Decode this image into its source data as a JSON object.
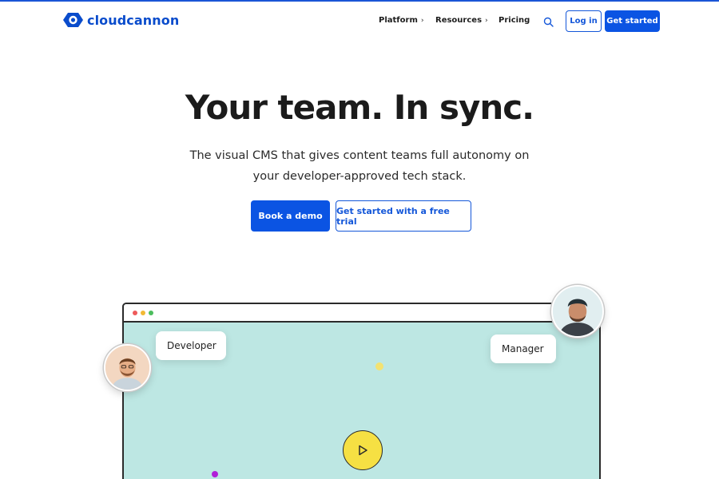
{
  "brand": {
    "name": "cloudcannon",
    "accent": "#0b54e3"
  },
  "nav": {
    "items": [
      {
        "label": "Platform",
        "has_submenu": true
      },
      {
        "label": "Resources",
        "has_submenu": true
      },
      {
        "label": "Pricing",
        "has_submenu": false
      }
    ],
    "chevron": "›",
    "search_icon": "search-icon",
    "login_label": "Log in",
    "get_started_label": "Get started"
  },
  "hero": {
    "title": "Your team. In sync.",
    "subtitle": "The visual CMS that gives content teams full autonomy on your developer-approved tech stack.",
    "primary_cta": "Book a demo",
    "secondary_cta": "Get started with a free trial"
  },
  "illustration": {
    "developer_label": "Developer",
    "manager_label": "Manager",
    "play_icon": "play-icon",
    "colors": {
      "panel": "#bde7e3",
      "play_button": "#f6e043",
      "purple_dot": "#b020d8"
    }
  }
}
